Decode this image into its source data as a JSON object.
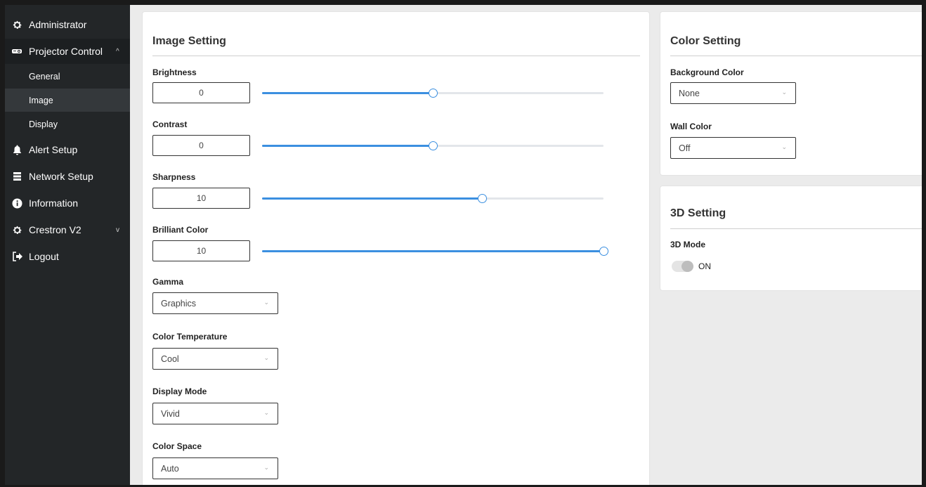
{
  "sidebar": {
    "items": [
      {
        "label": "Administrator",
        "icon": "gear-icon"
      },
      {
        "label": "Projector Control",
        "icon": "projector-icon",
        "chevron": "^"
      },
      {
        "label": "Alert Setup",
        "icon": "bell-icon"
      },
      {
        "label": "Network Setup",
        "icon": "server-icon"
      },
      {
        "label": "Information",
        "icon": "info-icon"
      },
      {
        "label": "Crestron V2",
        "icon": "gear-icon",
        "chevron": "v"
      },
      {
        "label": "Logout",
        "icon": "logout-icon"
      }
    ],
    "sub_items": [
      {
        "label": "General"
      },
      {
        "label": "Image",
        "active": true
      },
      {
        "label": "Display"
      }
    ]
  },
  "image_setting": {
    "title": "Image Setting",
    "sliders": [
      {
        "label": "Brightness",
        "value": "0",
        "fraction": 0.5
      },
      {
        "label": "Contrast",
        "value": "0",
        "fraction": 0.5
      },
      {
        "label": "Sharpness",
        "value": "10",
        "fraction": 0.644
      },
      {
        "label": "Brilliant Color",
        "value": "10",
        "fraction": 1.0
      }
    ],
    "selects": [
      {
        "label": "Gamma",
        "value": "Graphics"
      },
      {
        "label": "Color Temperature",
        "value": "Cool"
      },
      {
        "label": "Display Mode",
        "value": "Vivid"
      },
      {
        "label": "Color Space",
        "value": "Auto"
      }
    ]
  },
  "color_setting": {
    "title": "Color Setting",
    "selects": [
      {
        "label": "Background Color",
        "value": "None"
      },
      {
        "label": "Wall Color",
        "value": "Off"
      }
    ]
  },
  "setting_3d": {
    "title": "3D Setting",
    "mode_label": "3D Mode",
    "toggle_text": "ON"
  },
  "colors": {
    "sidebar_bg": "#232628",
    "accent": "#3b8fe0"
  }
}
